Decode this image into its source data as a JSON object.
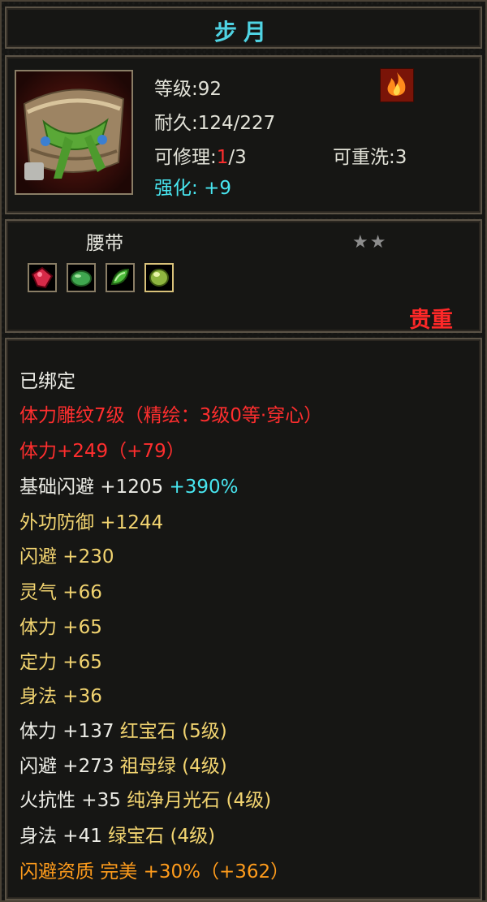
{
  "item": {
    "name": "步月",
    "level": "等级:92",
    "durability": "耐久:124/227",
    "repair_prefix": "可修理:",
    "repair_current": "1",
    "repair_suffix": "/3",
    "rewash": "可重洗:3",
    "enhance_label": "强化:",
    "enhance_value": "+9",
    "type": "腰带",
    "stars": "★★",
    "quality": "贵重"
  },
  "stats": [
    {
      "text": "已绑定"
    },
    {
      "text": "体力雕纹7级（精绘：3级0等·穿心）"
    },
    {
      "text": "体力+249（+79）"
    },
    {
      "label": "基础闪避 +1205",
      "bonus": "+390%"
    },
    {
      "text": "外功防御 +1244"
    },
    {
      "text": "闪避 +230"
    },
    {
      "text": "灵气 +66"
    },
    {
      "text": "体力 +65"
    },
    {
      "text": "定力 +65"
    },
    {
      "text": "身法 +36"
    },
    {
      "label": "体力 +137",
      "gem": "红宝石 (5级)"
    },
    {
      "label": "闪避 +273",
      "gem": "祖母绿 (4级)"
    },
    {
      "label": "火抗性 +35",
      "gem": "纯净月光石 (4级)"
    },
    {
      "label": "身法 +41",
      "gem": "绿宝石 (4级)"
    },
    {
      "text": "闪避资质  完美 +30%（+362）"
    }
  ],
  "icons": {
    "equipment": "belt-icon",
    "attribute": "fire-icon",
    "gems": [
      "ruby-gem-icon",
      "emerald-gem-icon",
      "jade-gem-icon",
      "green-gem-icon"
    ]
  },
  "colors": {
    "title": "#4fd3e3",
    "red": "#ff2e2e",
    "cyan": "#48e6f0",
    "white": "#ecece6",
    "yellow": "#f2d470",
    "orange": "#ff9c1c"
  }
}
